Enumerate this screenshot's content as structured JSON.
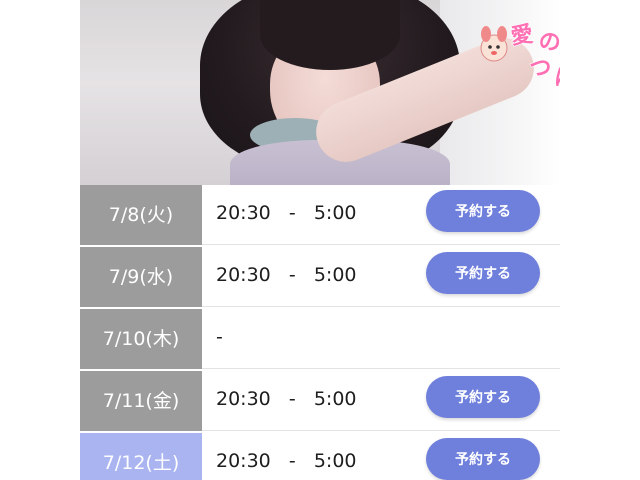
{
  "logo": {
    "text": "愛のつぼみ"
  },
  "schedule": [
    {
      "date": "7/8(火)",
      "time": "20:30   -   5:00",
      "button": "予約する",
      "highlight": false
    },
    {
      "date": "7/9(水)",
      "time": "20:30   -   5:00",
      "button": "予約する",
      "highlight": false
    },
    {
      "date": "7/10(木)",
      "time": "-",
      "button": null,
      "highlight": false
    },
    {
      "date": "7/11(金)",
      "time": "20:30   -   5:00",
      "button": "予約する",
      "highlight": false
    },
    {
      "date": "7/12(土)",
      "time": "20:30   -   5:00",
      "button": "予約する",
      "highlight": true
    }
  ],
  "colors": {
    "date_bg": "#9c9c9c",
    "date_today_bg": "#a9b4f0",
    "button_bg": "#6f7fdc"
  }
}
